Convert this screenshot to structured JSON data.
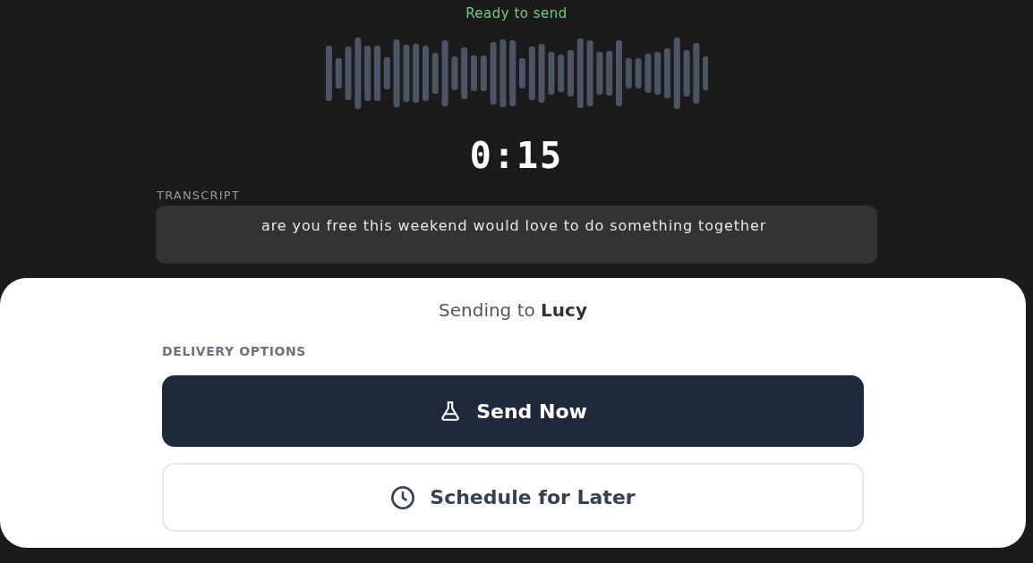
{
  "status": "Ready to send",
  "timer": "0:15",
  "transcript": {
    "label": "TRANSCRIPT",
    "text": "are you free this weekend would love to do something together"
  },
  "sheet": {
    "recipient_line": "Sending to **Lucy**",
    "section_label": "DELIVERY OPTIONS",
    "options": [
      {
        "label": "Send Now",
        "kind": "primary"
      },
      {
        "label": "Schedule for Later",
        "kind": "secondary"
      }
    ]
  }
}
